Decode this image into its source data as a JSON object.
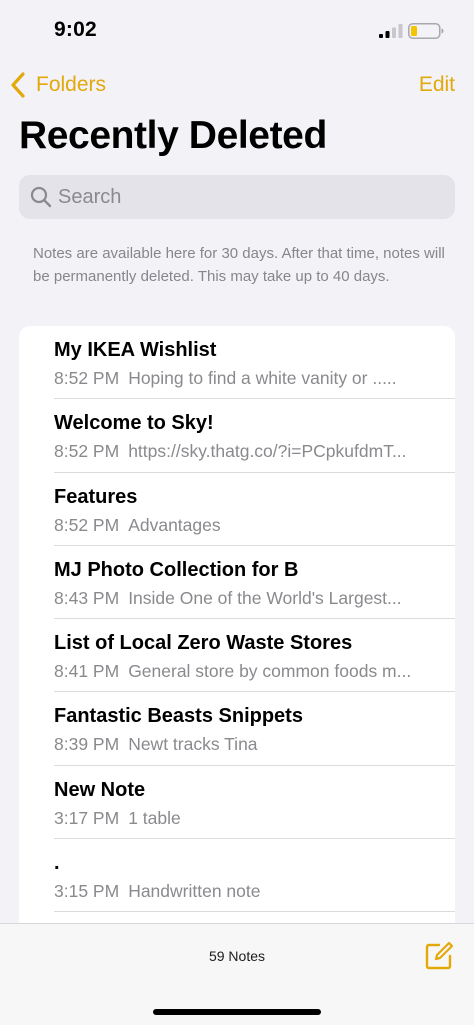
{
  "status_bar": {
    "time": "9:02"
  },
  "nav": {
    "back_label": "Folders",
    "edit_label": "Edit"
  },
  "title": "Recently Deleted",
  "search": {
    "placeholder": "Search"
  },
  "info_text": "Notes are available here for 30 days. After that time, notes will be permanently deleted. This may take up to 40 days.",
  "notes": [
    {
      "title": "My IKEA Wishlist",
      "time": "8:52 PM",
      "preview": "Hoping to find a white vanity or ....."
    },
    {
      "title": "Welcome to Sky!",
      "time": "8:52 PM",
      "preview": "https://sky.thatg.co/?i=PCpkufdmT..."
    },
    {
      "title": "Features",
      "time": "8:52 PM",
      "preview": "Advantages"
    },
    {
      "title": "MJ Photo Collection for B",
      "time": "8:43 PM",
      "preview": "Inside One of the World's Largest..."
    },
    {
      "title": "List of Local Zero Waste Stores",
      "time": "8:41 PM",
      "preview": "General store by common foods m..."
    },
    {
      "title": "Fantastic Beasts Snippets",
      "time": "8:39 PM",
      "preview": "Newt tracks Tina"
    },
    {
      "title": "New Note",
      "time": "3:17 PM",
      "preview": "1 table"
    },
    {
      "title": ".",
      "time": "3:15 PM",
      "preview": "Handwritten note"
    }
  ],
  "toolbar": {
    "count": "59 Notes"
  },
  "icons": {
    "back": "chevron-left-icon",
    "search": "magnifier-icon",
    "compose": "compose-icon",
    "signal": "cellular-signal-icon",
    "battery": "battery-low-icon"
  },
  "colors": {
    "accent": "#e3a90b",
    "background": "#f2f2f7",
    "card": "#ffffff",
    "secondary_text": "#8a8a8e",
    "battery_fill": "#f5c400"
  }
}
